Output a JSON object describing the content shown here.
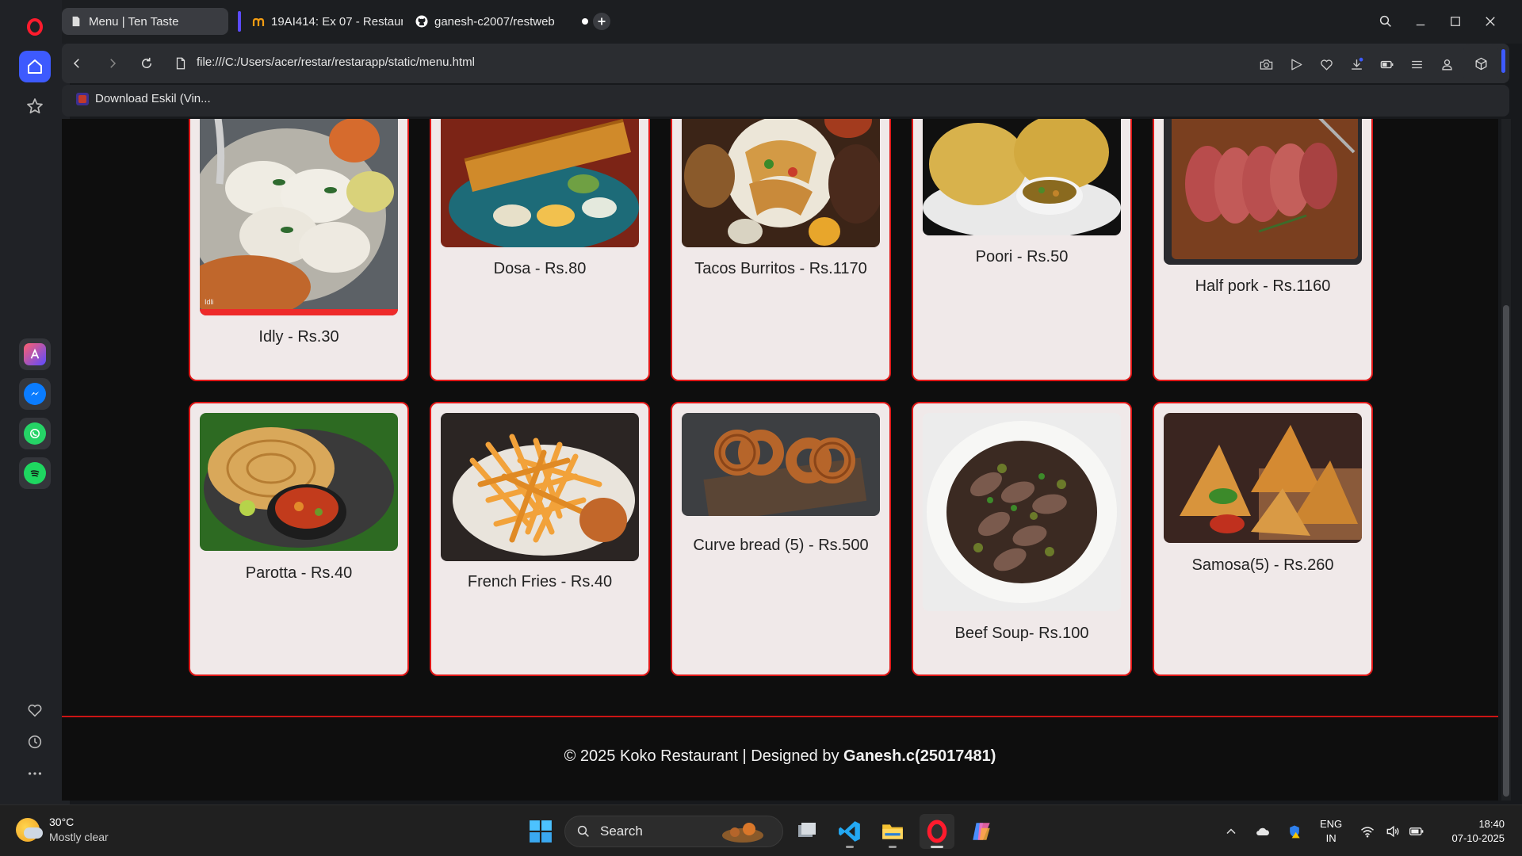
{
  "browser": {
    "tabs": [
      {
        "label": "Menu | Ten Taste",
        "active": true,
        "icon": "document-icon"
      },
      {
        "label": "19AI414: Ex 07 - Restaurant",
        "active": false,
        "icon": "moodle-icon"
      },
      {
        "label": "ganesh-c2007/restweb",
        "active": false,
        "icon": "github-icon"
      }
    ],
    "url": "file:///C:/Users/acer/restar/restarapp/static/menu.html",
    "bookmarks": [
      {
        "label": "Download Eskil (Vin..."
      }
    ]
  },
  "menu": {
    "items": [
      {
        "name": "Idly - Rs.30",
        "image": "idly-image"
      },
      {
        "name": "Dosa - Rs.80",
        "image": "dosa-image"
      },
      {
        "name": "Tacos Burritos - Rs.1170",
        "image": "tacos-image"
      },
      {
        "name": "Poori - Rs.50",
        "image": "poori-image"
      },
      {
        "name": "Half pork - Rs.1160",
        "image": "pork-image"
      },
      {
        "name": "Parotta - Rs.40",
        "image": "parotta-image"
      },
      {
        "name": "French Fries - Rs.40",
        "image": "fries-image"
      },
      {
        "name": "Curve bread (5) - Rs.500",
        "image": "pretzel-image"
      },
      {
        "name": "Beef Soup- Rs.100",
        "image": "beef-image"
      },
      {
        "name": "Samosa(5) - Rs.260",
        "image": "samosa-image"
      }
    ],
    "idly_watermark": "Idli"
  },
  "footer": {
    "text": "© 2025 Koko Restaurant | Designed by ",
    "author": "Ganesh.c(25017481)"
  },
  "taskbar": {
    "weather": {
      "temp": "30°C",
      "desc": "Mostly clear"
    },
    "search_label": "Search",
    "lang_line1": "ENG",
    "lang_line2": "IN",
    "time": "18:40",
    "date": "07-10-2025"
  },
  "colors": {
    "card_bg": "#f0e9e9",
    "card_border": "#e01818",
    "page_bg": "#0e0e0e",
    "footer_line": "#cc1414",
    "opera_red": "#ff1b2d"
  }
}
